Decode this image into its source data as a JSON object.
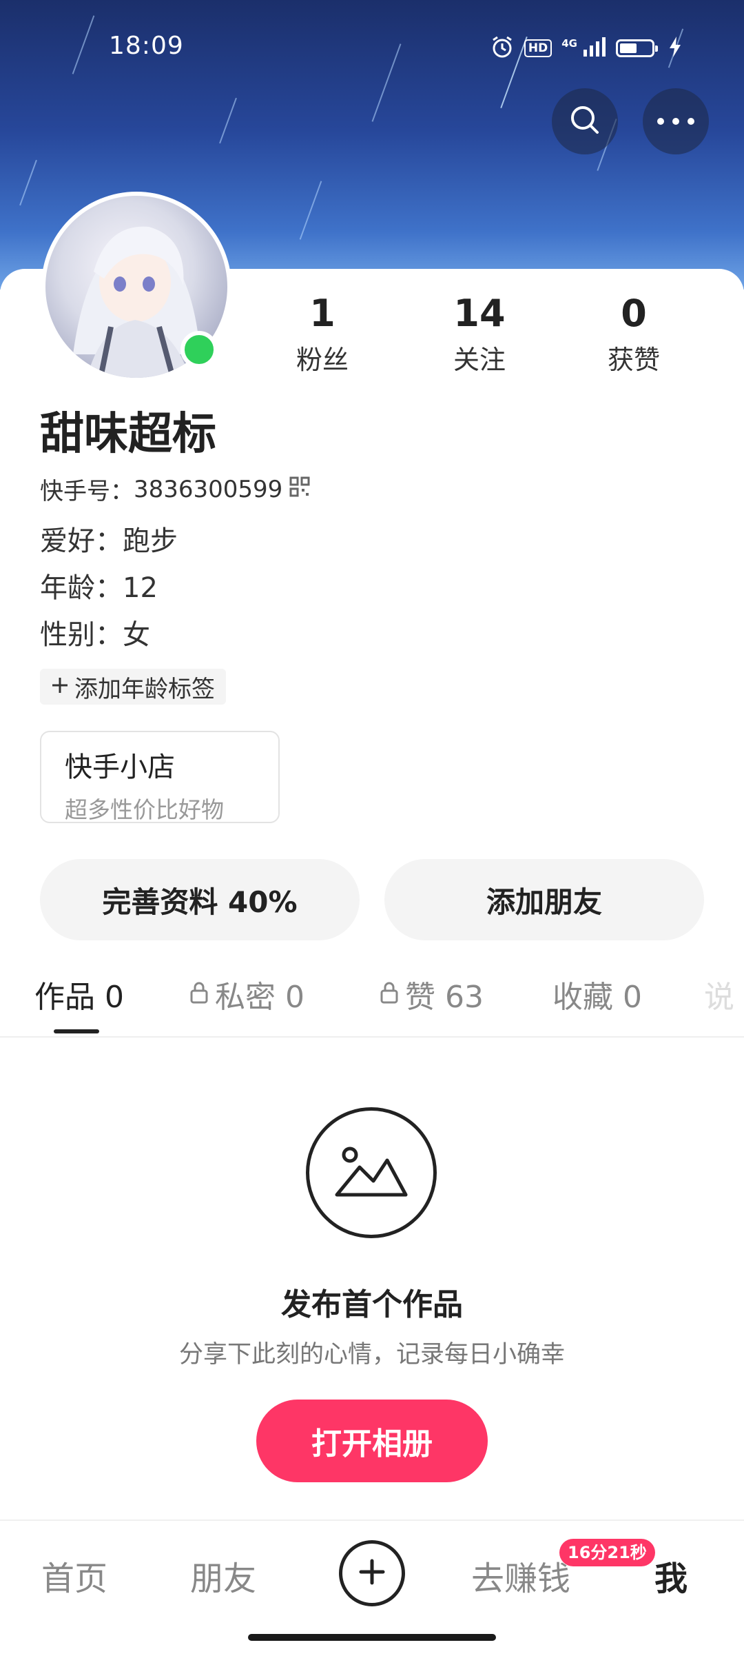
{
  "status_bar": {
    "time": "18:09",
    "icons": [
      "alarm-icon",
      "hd-icon",
      "4g-signal-icon",
      "battery-icon",
      "charging-icon"
    ],
    "hd_label": "HD",
    "network_label": "4G"
  },
  "header_actions": {
    "search_icon": "search-icon",
    "more_icon": "more-icon"
  },
  "profile": {
    "stats": [
      {
        "value": "1",
        "label": "粉丝"
      },
      {
        "value": "14",
        "label": "关注"
      },
      {
        "value": "0",
        "label": "获赞"
      }
    ],
    "name": "甜味超标",
    "id_label": "快手号：",
    "id_value": "3836300599",
    "info": [
      {
        "label": "爱好：",
        "value": "跑步"
      },
      {
        "label": "年龄：",
        "value": "12"
      },
      {
        "label": "性别：",
        "value": "女"
      }
    ],
    "add_tag_label": "添加年龄标签",
    "shop": {
      "title": "快手小店",
      "subtitle": "超多性价比好物"
    },
    "complete_profile_label": "完善资料 40%",
    "add_friend_label": "添加朋友"
  },
  "tabs": [
    {
      "label": "作品 0",
      "locked": false,
      "active": true
    },
    {
      "label": "私密 0",
      "locked": true,
      "active": false
    },
    {
      "label": "赞 63",
      "locked": true,
      "active": false
    },
    {
      "label": "收藏 0",
      "locked": false,
      "active": false
    },
    {
      "label": "说",
      "locked": false,
      "active": false
    }
  ],
  "empty_state": {
    "title": "发布首个作品",
    "subtitle": "分享下此刻的心情，记录每日小确幸",
    "button_label": "打开相册"
  },
  "bottom_nav": {
    "home": "首页",
    "friends": "朋友",
    "earn": "去赚钱",
    "earn_badge": "16分21秒",
    "me": "我"
  },
  "colors": {
    "accent": "#fe3666",
    "online": "#2fd05a",
    "banner_top": "#1b2f6b",
    "banner_bottom": "#6ea3e6"
  }
}
